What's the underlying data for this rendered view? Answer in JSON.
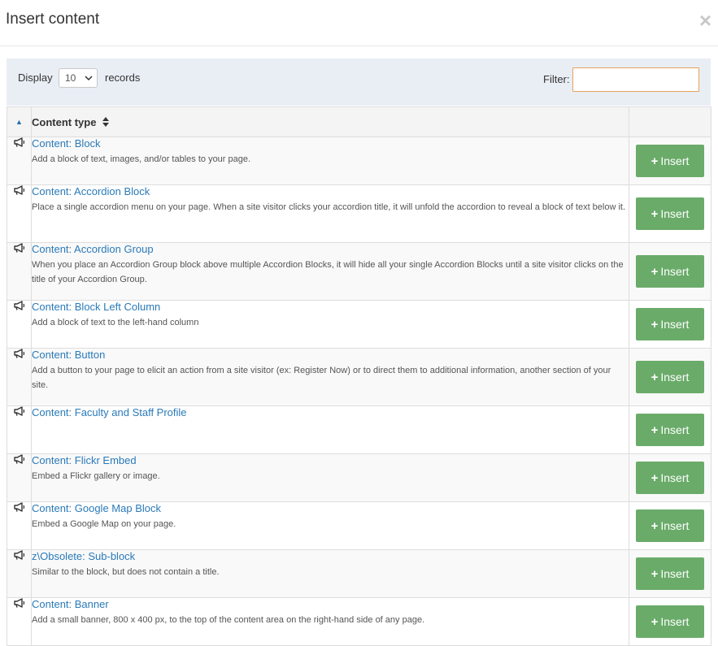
{
  "dialog": {
    "title": "Insert content",
    "close_icon": "×"
  },
  "controls": {
    "display_label": "Display",
    "page_size": "10",
    "records_label": "records",
    "filter_label": "Filter:",
    "filter_value": ""
  },
  "table": {
    "sort_indicator": "▲",
    "header_content_type": "Content type",
    "header_sort_icon": "▲▼",
    "insert_label": "Insert",
    "rows": [
      {
        "title": "Content: Block",
        "description": "Add a block of text, images, and/or tables to your page."
      },
      {
        "title": "Content: Accordion Block",
        "description": "Place a single accordion menu on your page. When a site visitor clicks your accordion title, it will unfold the accordion to reveal a block of text below it."
      },
      {
        "title": "Content: Accordion Group",
        "description": "When you place an Accordion Group block above multiple Accordion Blocks, it will hide all your single Accordion Blocks until a site visitor clicks on the title of your Accordion Group."
      },
      {
        "title": "Content: Block Left Column",
        "description": "Add a block of text to the left-hand column"
      },
      {
        "title": "Content: Button",
        "description": "Add a button to your page to elicit an action from a site visitor (ex: Register Now) or to direct them to additional information, another section of your site."
      },
      {
        "title": "Content: Faculty and Staff Profile",
        "description": ""
      },
      {
        "title": "Content: Flickr Embed",
        "description": "Embed a Flickr gallery or image."
      },
      {
        "title": "Content: Google Map Block",
        "description": "Embed a Google Map on your page."
      },
      {
        "title": "z\\Obsolete: Sub-block",
        "description": "Similar to the block, but does not contain a title."
      },
      {
        "title": "Content: Banner",
        "description": "Add a small banner, 800 x 400 px, to the top of the content area on the right-hand side of any page."
      }
    ]
  },
  "icons": {
    "row_icon": "megaphone-icon",
    "insert_icon": "plus-icon"
  },
  "colors": {
    "link": "#2a7ab8",
    "insert_button": "#6aab6a",
    "filter_focus_border": "#e8a05b",
    "controls_background": "#e9eef5"
  }
}
